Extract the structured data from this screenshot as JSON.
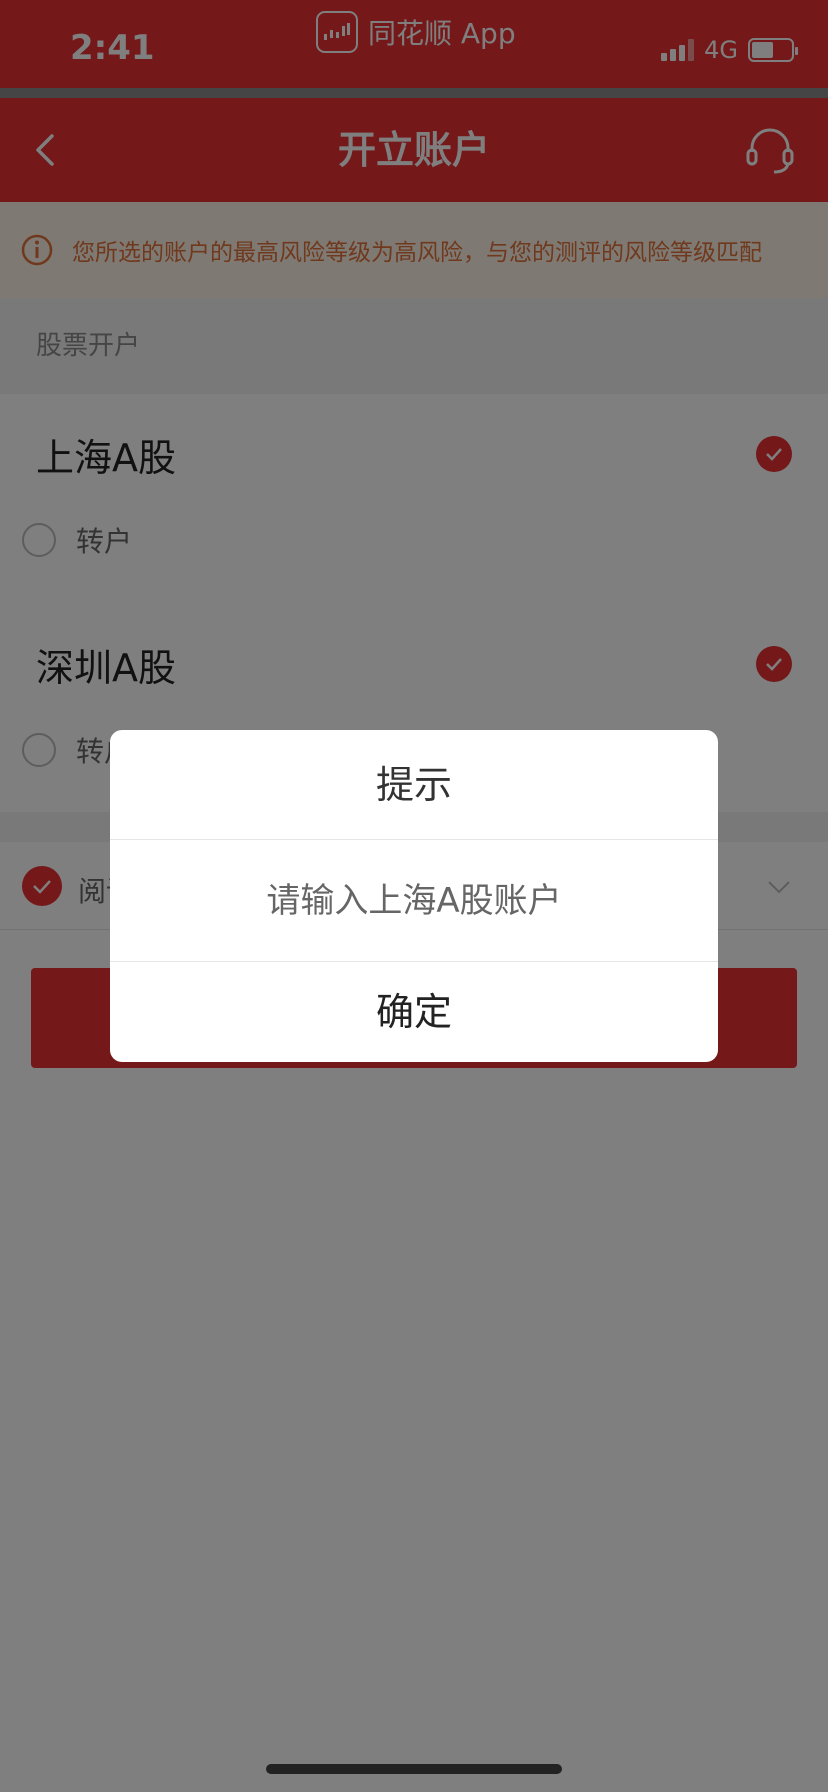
{
  "status_bar": {
    "time": "2:41",
    "app_name": "同花顺 App",
    "network": "4G"
  },
  "nav": {
    "title": "开立账户",
    "back_icon": "chevron-left-icon",
    "support_icon": "headset-icon"
  },
  "warning": {
    "text": "您所选的账户的最高风险等级为高风险，与您的测评的风险等级匹配",
    "icon": "info-icon"
  },
  "section": {
    "title": "股票开户"
  },
  "markets": [
    {
      "name": "上海A股",
      "checked": true,
      "option_label": "转户"
    },
    {
      "name": "深圳A股",
      "checked": true,
      "option_label": "转户"
    }
  ],
  "agreement": {
    "label": "阅读并同意"
  },
  "dialog": {
    "title": "提示",
    "message": "请输入上海A股账户",
    "confirm_label": "确定"
  },
  "colors": {
    "brand_red": "#e93033",
    "warning_orange": "#e0733a"
  }
}
